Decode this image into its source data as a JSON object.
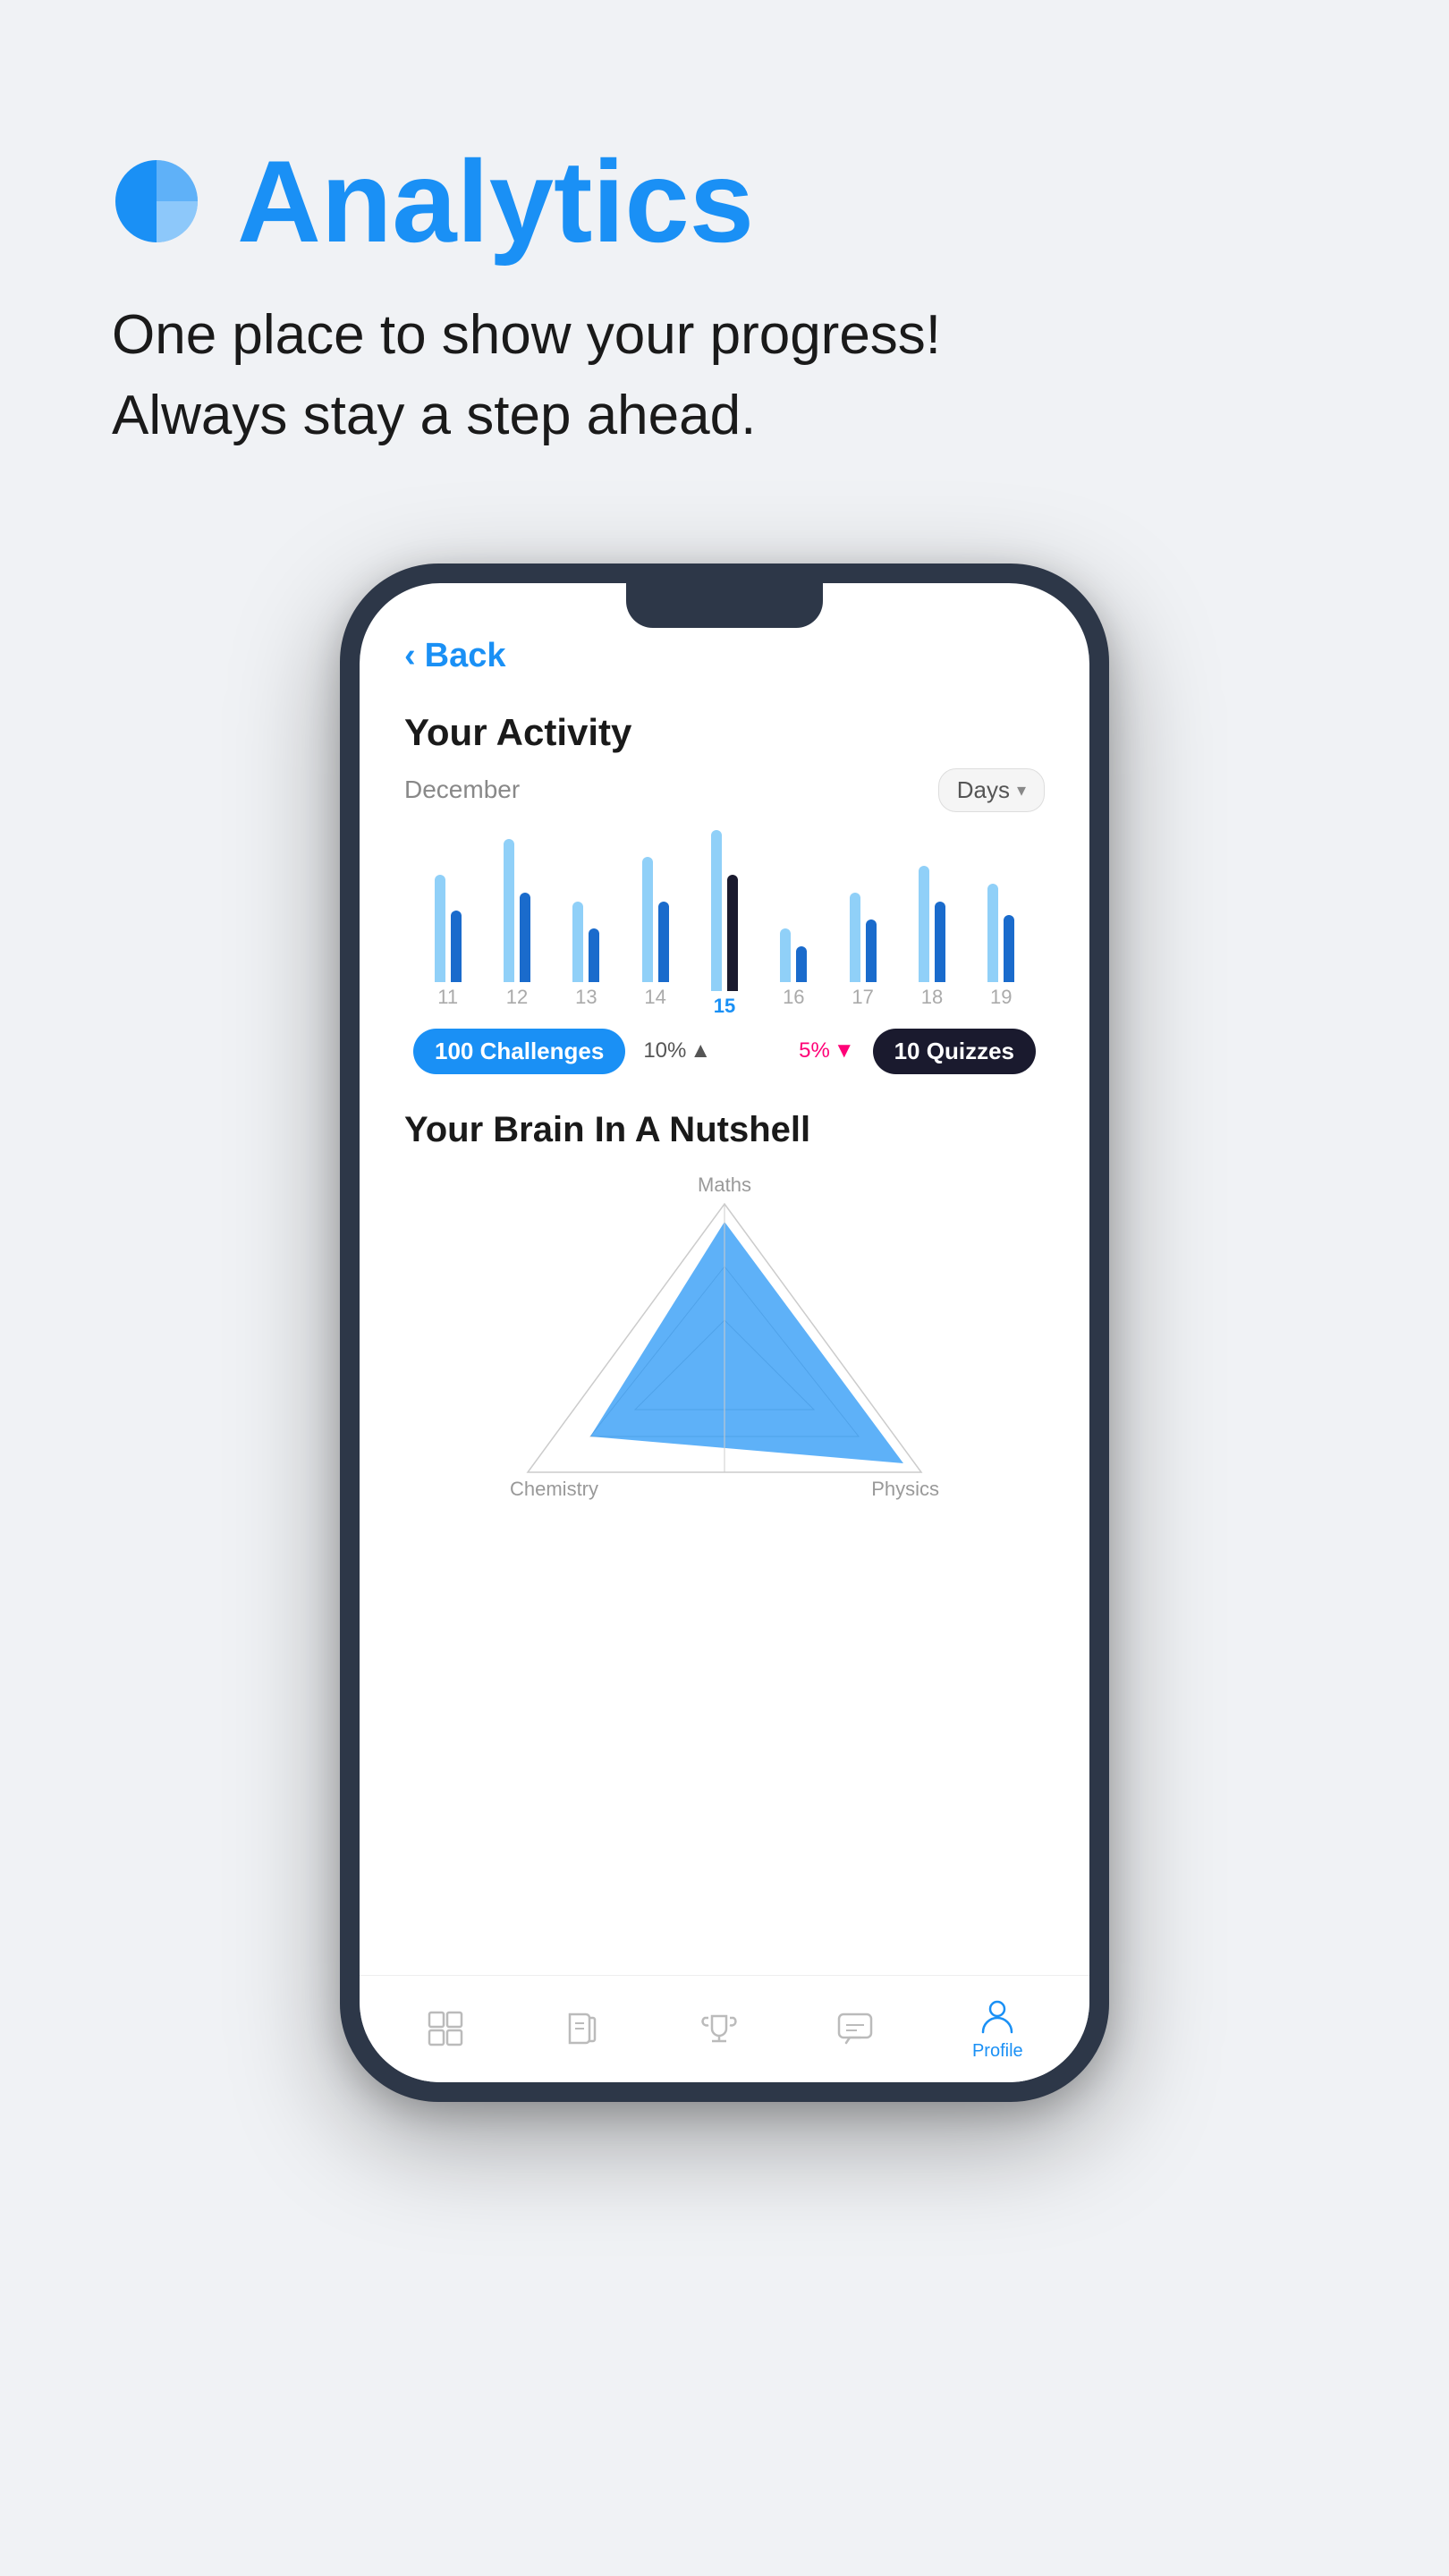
{
  "page": {
    "background_color": "#f0f2f5"
  },
  "header": {
    "icon_label": "analytics-pie-icon",
    "title": "Analytics",
    "subtitle_line1": "One place to show your progress!",
    "subtitle_line2": "Always stay a step ahead."
  },
  "phone_screen": {
    "back_button_label": "Back",
    "activity_section": {
      "title": "Your Activity",
      "month_label": "December",
      "filter_label": "Days",
      "days": [
        {
          "day": "11",
          "bar1_height": 120,
          "bar2_height": 80,
          "selected": false
        },
        {
          "day": "12",
          "bar1_height": 160,
          "bar2_height": 100,
          "selected": false
        },
        {
          "day": "13",
          "bar1_height": 90,
          "bar2_height": 60,
          "selected": false
        },
        {
          "day": "14",
          "bar1_height": 140,
          "bar2_height": 90,
          "selected": false
        },
        {
          "day": "15",
          "bar1_height": 180,
          "bar2_height": 130,
          "selected": true
        },
        {
          "day": "16",
          "bar1_height": 60,
          "bar2_height": 40,
          "selected": false
        },
        {
          "day": "17",
          "bar1_height": 100,
          "bar2_height": 70,
          "selected": false
        },
        {
          "day": "18",
          "bar1_height": 130,
          "bar2_height": 90,
          "selected": false
        },
        {
          "day": "19",
          "bar1_height": 110,
          "bar2_height": 75,
          "selected": false
        }
      ],
      "stats": {
        "challenges_badge": "100 Challenges",
        "change_up_label": "10%",
        "change_down_label": "5%",
        "quizzes_badge": "10 Quizzes"
      }
    },
    "brain_section": {
      "title": "Your Brain In A Nutshell",
      "labels": {
        "top": "Maths",
        "bottom_left": "Chemistry",
        "bottom_right": "Physics"
      }
    },
    "bottom_nav": {
      "items": [
        {
          "label": "",
          "icon": "grid-icon",
          "active": false
        },
        {
          "label": "",
          "icon": "book-icon",
          "active": false
        },
        {
          "label": "",
          "icon": "trophy-icon",
          "active": false
        },
        {
          "label": "",
          "icon": "chat-icon",
          "active": false
        },
        {
          "label": "Profile",
          "icon": "profile-icon",
          "active": true
        }
      ]
    }
  }
}
